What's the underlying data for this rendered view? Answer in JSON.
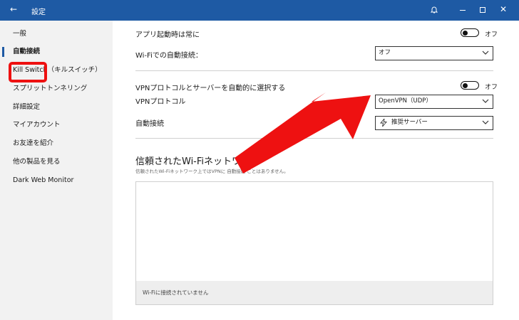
{
  "window": {
    "title": "設定",
    "back_icon": "back-arrow-icon",
    "bell_icon": "bell-icon"
  },
  "sidebar": {
    "items": [
      {
        "label": "一般"
      },
      {
        "label": "自動接続"
      },
      {
        "label": "Kill Switch（キルスイッチ）"
      },
      {
        "label": "スプリットトンネリング"
      },
      {
        "label": "詳細設定"
      },
      {
        "label": "マイアカウント"
      },
      {
        "label": "お友達を紹介"
      },
      {
        "label": "他の製品を見る"
      },
      {
        "label": "Dark Web Monitor"
      }
    ],
    "active_index": 1
  },
  "settings": {
    "launch_label": "アプリ起動時は常に",
    "launch_toggle": "オフ",
    "wifi_auto_label": "Wi-Fiでの自動接続：",
    "wifi_auto_value": "オフ",
    "vpn_auto_select_label": "VPNプロトコルとサーバーを自動的に選択する",
    "vpn_auto_select_toggle": "オフ",
    "protocol_label": "VPNプロトコル",
    "protocol_value": "OpenVPN（UDP）",
    "autoconnect_label": "自動接続",
    "autoconnect_value": "推奨サーバー"
  },
  "trusted": {
    "title": "信頼されたWi-Fiネットワーク",
    "description": "信頼されたWi-Fiネットワーク上ではVPNに 自動接続 ことはありません。",
    "empty_text": "Wi-Fiに接続されていません"
  },
  "colors": {
    "accent": "#1e5aa4",
    "annotation": "#ee1111"
  }
}
